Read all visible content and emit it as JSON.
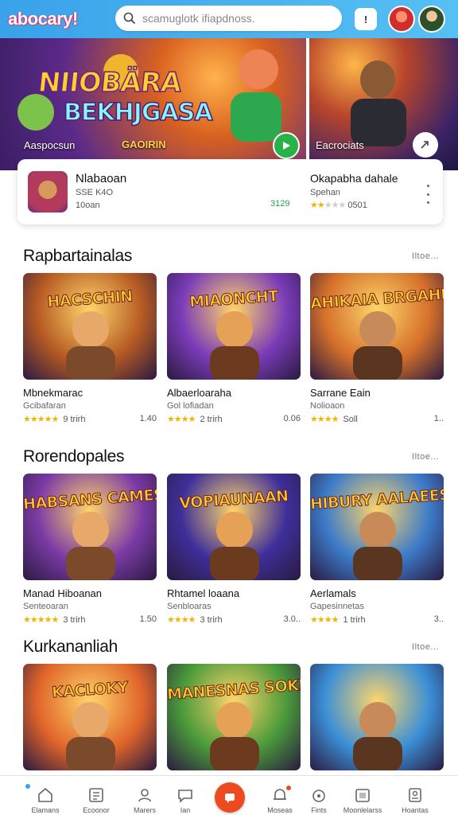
{
  "app": {
    "logo": "abocary!",
    "search_placeholder": "scamuglotk ifiapdnoss.",
    "notif_label": "!"
  },
  "hero": {
    "title_line1": "NIIOBÄRA",
    "title_line2": "BEKHJGASA",
    "caption_left": "Aaspocsun",
    "caption_mid": "GAOIRIN",
    "caption_right": "Eacrociats"
  },
  "info_card": {
    "left": {
      "title": "Nlabaoan",
      "line1": "SSE K4O",
      "line2": "10oan",
      "count": "3129"
    },
    "right": {
      "title": "Okapabha dahale",
      "line1": "Spehan",
      "rating_text": "0501",
      "stars_filled": 2,
      "stars_total": 5
    }
  },
  "sections": [
    {
      "title": "Rapbartainalas",
      "more": "Iltoe...",
      "cards": [
        {
          "thumb_text": "HACSCHIN",
          "title": "Mbnekmarac",
          "sub": "Gcibafaran",
          "stars": "★★★★★",
          "rating_text": "9 trirh",
          "count": "1.40",
          "bg": "#b55a23"
        },
        {
          "thumb_text": "MIAONCHT",
          "title": "Albaerloaraha",
          "sub": "Gol lofiadan",
          "stars": "★★★★",
          "rating_text": "2 trirh",
          "count": "0.06",
          "bg": "#7a3bb8"
        },
        {
          "thumb_text": "AHIKAIA BRGAHE",
          "title": "Sarrane Eain",
          "sub": "Nolioaon",
          "stars": "★★★★",
          "rating_text": "Soll",
          "count": "1..",
          "bg": "#d5702a"
        }
      ]
    },
    {
      "title": "Rorendopales",
      "more": "Iltoe...",
      "cards": [
        {
          "thumb_text": "HABSANS CAMES",
          "title": "Manad Hiboanan",
          "sub": "Senteoaran",
          "stars": "★★★★★",
          "rating_text": "3 trirh",
          "count": "1.50",
          "bg": "#7b3aa6"
        },
        {
          "thumb_text": "VOPIAUNAAN",
          "title": "Rhtamel loaana",
          "sub": "Senbloaras",
          "stars": "★★★★",
          "rating_text": "3 trirh",
          "count": "3.0..",
          "bg": "#3e2f9a"
        },
        {
          "thumb_text": "HIBURY AALAEES",
          "title": "Aerlamals",
          "sub": "Gapesinnetas",
          "stars": "★★★★",
          "rating_text": "1 trirh",
          "count": "3..",
          "bg": "#3c7bc9"
        }
      ]
    },
    {
      "title": "Kurkananliah",
      "more": "Iltoe...",
      "cards": [
        {
          "thumb_text": "KACLOKY",
          "bg": "#e0652a"
        },
        {
          "thumb_text": "MANESNAS SOKIOEL",
          "bg": "#4a9a3a"
        },
        {
          "thumb_text": "",
          "bg": "#3b8fd6"
        }
      ]
    }
  ],
  "bottom_nav": [
    {
      "label": "Elamans",
      "icon": "home-icon"
    },
    {
      "label": "Ecoonor",
      "icon": "list-icon"
    },
    {
      "label": "Marers",
      "icon": "user-icon"
    },
    {
      "label": "Ian",
      "icon": "chat-icon"
    },
    {
      "label": "",
      "icon": "play-center-icon"
    },
    {
      "label": "Moseas",
      "icon": "bell-icon"
    },
    {
      "label": "Fints",
      "icon": "game-icon"
    },
    {
      "label": "Moonlelarss",
      "icon": "store-icon"
    },
    {
      "label": "Hoantas",
      "icon": "profile-icon"
    }
  ]
}
